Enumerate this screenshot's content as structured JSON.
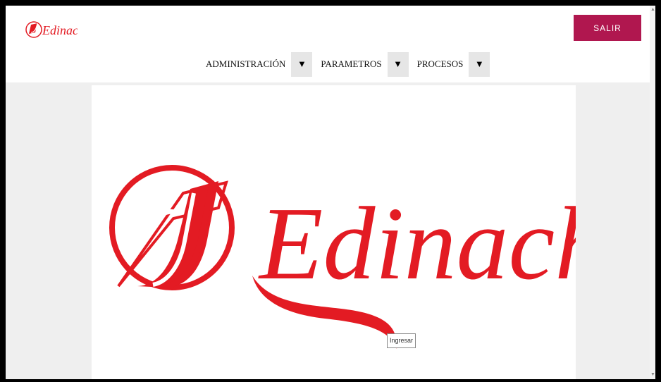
{
  "header": {
    "logo_text": "Edinacho",
    "logout_label": "SALIR"
  },
  "nav": {
    "items": [
      {
        "label": "ADMINISTRACIÓN",
        "dropdown": "▼"
      },
      {
        "label": "PARAMETROS",
        "dropdown": "▼"
      },
      {
        "label": "PROCESOS",
        "dropdown": "▼"
      }
    ]
  },
  "hero": {
    "logo_text": "Edinacho",
    "tooltip": "Ingresar"
  },
  "colors": {
    "brand_red": "#e31b23",
    "logout_bg": "#b0174f"
  },
  "icons": {
    "small_logo": "edinacho-logo-icon",
    "dropdown": "triangle-down-icon",
    "scroll_up": "scroll-up-icon",
    "scroll_down": "scroll-down-icon"
  }
}
